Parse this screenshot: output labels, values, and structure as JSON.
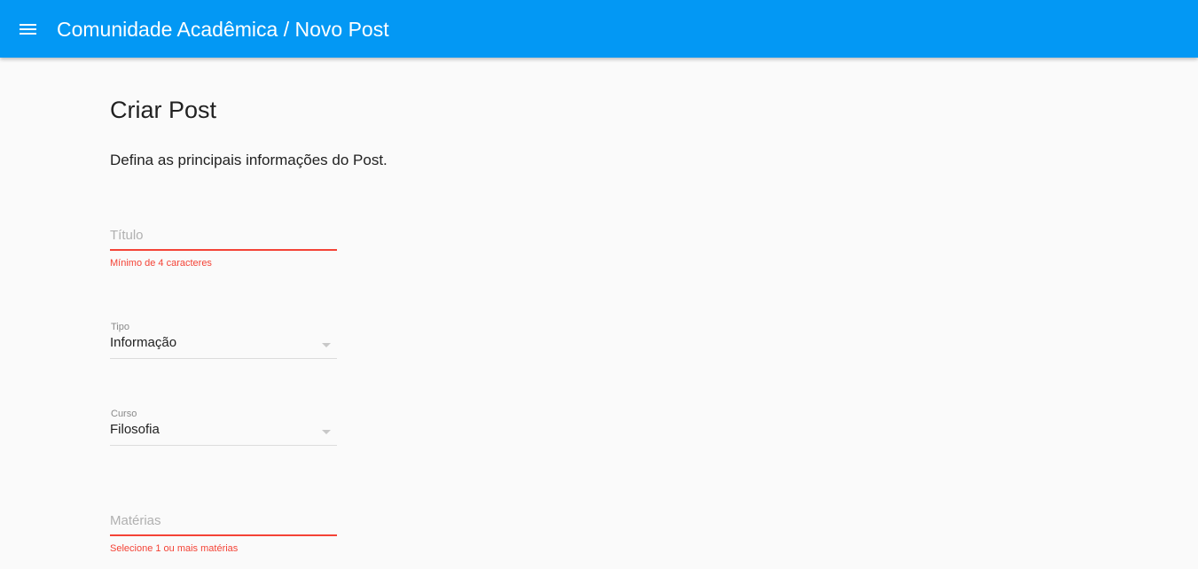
{
  "toolbar": {
    "title": "Comunidade Acadêmica / Novo Post",
    "menu_icon": "hamburger-menu-icon",
    "color": "#0398f4"
  },
  "page": {
    "title": "Criar Post",
    "subtitle": "Defina as principais informações do Post."
  },
  "form": {
    "titulo": {
      "placeholder": "Título",
      "value": "",
      "error": "Mínimo de 4 caracteres"
    },
    "tipo": {
      "label": "Tipo",
      "selected": "Informação"
    },
    "curso": {
      "label": "Curso",
      "selected": "Filosofia"
    },
    "materias": {
      "placeholder": "Matérias",
      "value": "",
      "error": "Selecione 1 ou mais matérias"
    }
  },
  "colors": {
    "error": "#f44336",
    "background": "#fafafa"
  }
}
